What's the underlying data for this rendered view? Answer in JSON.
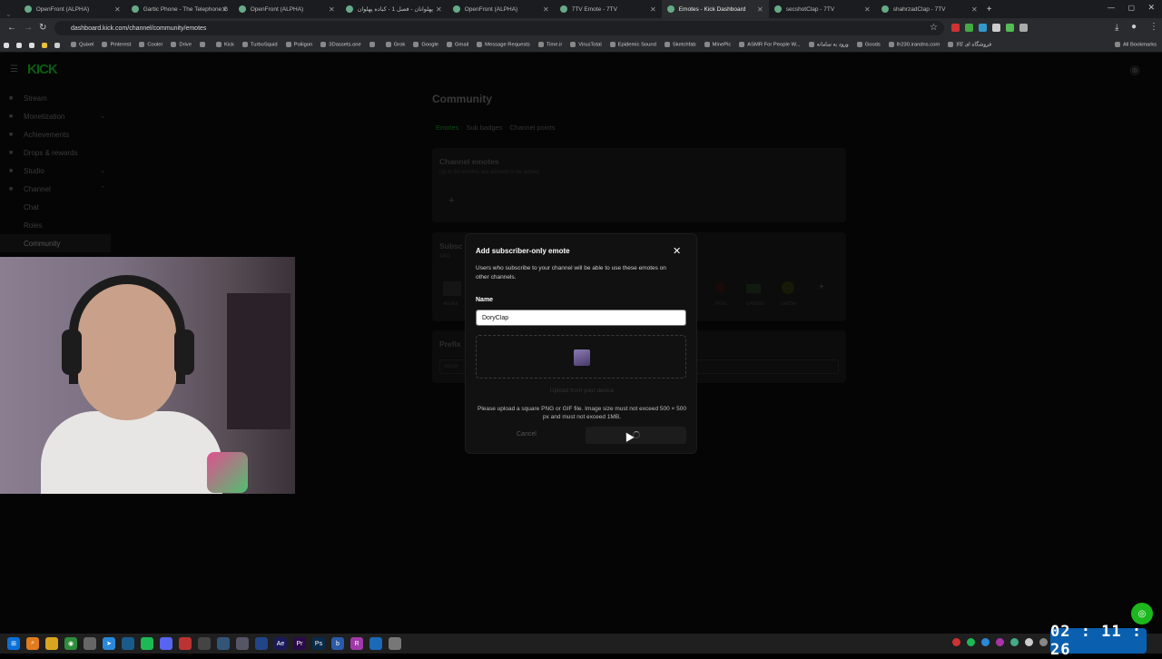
{
  "browser": {
    "tabs": [
      {
        "title": "OpenFront (ALPHA)"
      },
      {
        "title": "Gartic Phone - The Telephone G"
      },
      {
        "title": "OpenFront (ALPHA)"
      },
      {
        "title": "پهلوانان - فصل 1 - کباده پهلوان"
      },
      {
        "title": "OpenFront (ALPHA)"
      },
      {
        "title": "7TV Emote - 7TV"
      },
      {
        "title": "Emotes - Kick Dashboard",
        "active": true
      },
      {
        "title": "secshotClap - 7TV"
      },
      {
        "title": "shahrzadClap - 7TV"
      }
    ],
    "url": "dashboard.kick.com/channel/community/emotes",
    "bookmarks": [
      "Quixel",
      "Pinterest",
      "Cooler",
      "Drive",
      "",
      "Kick",
      "TurboSquid",
      "Poliigon",
      "3Dassets.one",
      "",
      "Grok",
      "Google",
      "Gmail",
      "Message Requests",
      "Time.ir",
      "VirusTotal",
      "Epidemic Sound",
      "Sketchfab",
      "MinePic",
      "ASMR For People W...",
      "ورود به سامانه",
      "Goods",
      "lh230.irandns.com",
      "فروشگاه ای کالا"
    ],
    "all_bookmarks": "All Bookmarks"
  },
  "kick": {
    "logo": "KICK",
    "nav": [
      {
        "label": "Stream",
        "icon": "stream-icon"
      },
      {
        "label": "Monetization",
        "icon": "dollar-icon",
        "chevron": "⌄"
      },
      {
        "label": "Achievements",
        "icon": "trophy-icon"
      },
      {
        "label": "Drops & rewards",
        "icon": "gift-icon"
      },
      {
        "label": "Studio",
        "icon": "studio-icon",
        "chevron": "⌄"
      },
      {
        "label": "Channel",
        "icon": "channel-icon",
        "chevron": "⌃"
      },
      {
        "label": "Chat",
        "sub": true
      },
      {
        "label": "Roles",
        "sub": true
      },
      {
        "label": "Community",
        "sub": true,
        "selected": true
      }
    ],
    "page_title": "Community",
    "tabs": [
      "Emotes",
      "Sub badges",
      "Channel points"
    ],
    "channel_emotes": {
      "title": "Channel emotes",
      "subtitle": "Up to 60 emotes are allowed to be added",
      "add": "+"
    },
    "sub_emotes": {
      "title": "Subsc",
      "count": "4/60",
      "emotes": [
        "AdaBit",
        "POG",
        "SADGE",
        "SHISH"
      ],
      "add": "+"
    },
    "prefix": {
      "title": "Prefix",
      "value": "secsh"
    }
  },
  "modal": {
    "title": "Add subscriber-only emote",
    "description": "Users who subscribe to your channel will be able to use these emotes on other channels.",
    "name_label": "Name",
    "name_value": "DoryClap",
    "upload_link": "Upload from your device",
    "help": "Please upload a square PNG or GIF file. Image size must not exceed 500 × 500 px and must not exceed 1MB.",
    "cancel": "Cancel",
    "close": "✕"
  },
  "clock": "02 : 11 : 26",
  "colors": {
    "accent": "#53fc18",
    "clock_bg": "#0a5fae"
  }
}
